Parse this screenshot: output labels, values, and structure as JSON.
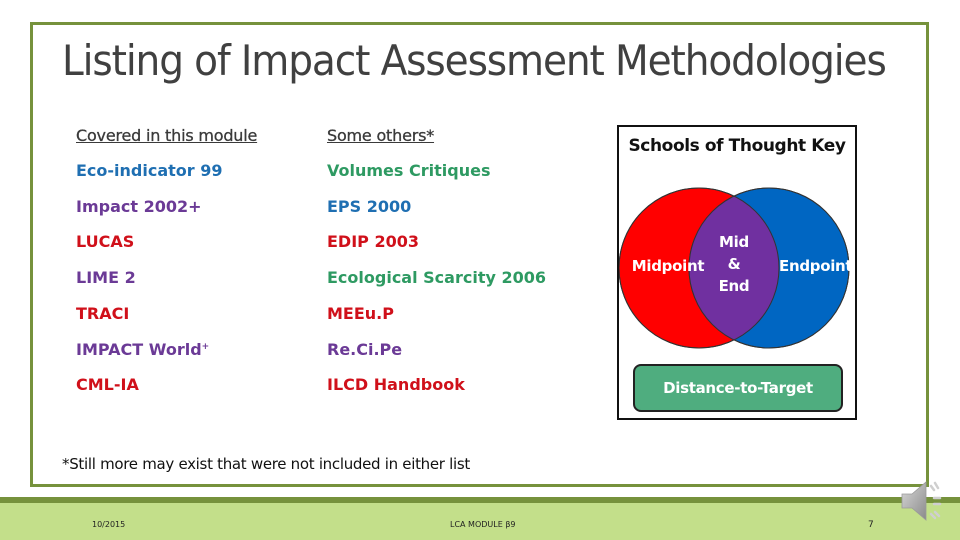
{
  "slide": {
    "title": "Listing of Impact Assessment Methodologies",
    "columns": [
      {
        "header": "Covered in this module",
        "items": [
          {
            "label": "Eco-indicator 99",
            "school": "endpoint",
            "color": "#1f6fb2"
          },
          {
            "label": "Impact 2002+",
            "school": "mid-end",
            "color": "#6b3a96"
          },
          {
            "label": "LUCAS",
            "school": "midpoint",
            "color": "#d0101a"
          },
          {
            "label": "LIME 2",
            "school": "mid-end",
            "color": "#6b3a96"
          },
          {
            "label": "TRACI",
            "school": "midpoint",
            "color": "#d0101a"
          },
          {
            "label": "IMPACT World",
            "sup": "+",
            "school": "mid-end",
            "color": "#6b3a96"
          },
          {
            "label": "CML-IA",
            "school": "midpoint",
            "color": "#d0101a"
          }
        ]
      },
      {
        "header": "Some others*",
        "items": [
          {
            "label": "Volumes Critiques",
            "school": "distance-to-target",
            "color": "#2e9a62"
          },
          {
            "label": "EPS 2000",
            "school": "endpoint",
            "color": "#1f6fb2"
          },
          {
            "label": "EDIP 2003",
            "school": "midpoint",
            "color": "#d0101a"
          },
          {
            "label": "Ecological Scarcity 2006",
            "school": "distance-to-target",
            "color": "#2e9a62"
          },
          {
            "label": "MEEu.P",
            "school": "midpoint",
            "color": "#d0101a"
          },
          {
            "label": "Re.Ci.Pe",
            "school": "mid-end",
            "color": "#6b3a96"
          },
          {
            "label": "ILCD Handbook",
            "school": "midpoint",
            "color": "#d0101a"
          }
        ]
      }
    ],
    "key": {
      "title": "Schools of Thought Key",
      "midpoint": {
        "label": "Midpoint",
        "color": "#ff0000"
      },
      "endpoint": {
        "label": "Endpoint",
        "color": "#0066c2"
      },
      "overlap": {
        "line1": "Mid",
        "line2": "&",
        "line3": "End",
        "color": "#7030a0"
      },
      "distance_to_target": {
        "label": "Distance-to-Target",
        "color": "#4fad7f"
      }
    },
    "footnote": "*Still more may exist that were not included in either list"
  },
  "footer": {
    "date": "10/2015",
    "module": "LCA MODULE β9",
    "page": "7"
  },
  "audio": {
    "icon": "speaker-icon"
  },
  "theme": {
    "frame": "#76923c",
    "footer_band": "#c3df8a"
  }
}
